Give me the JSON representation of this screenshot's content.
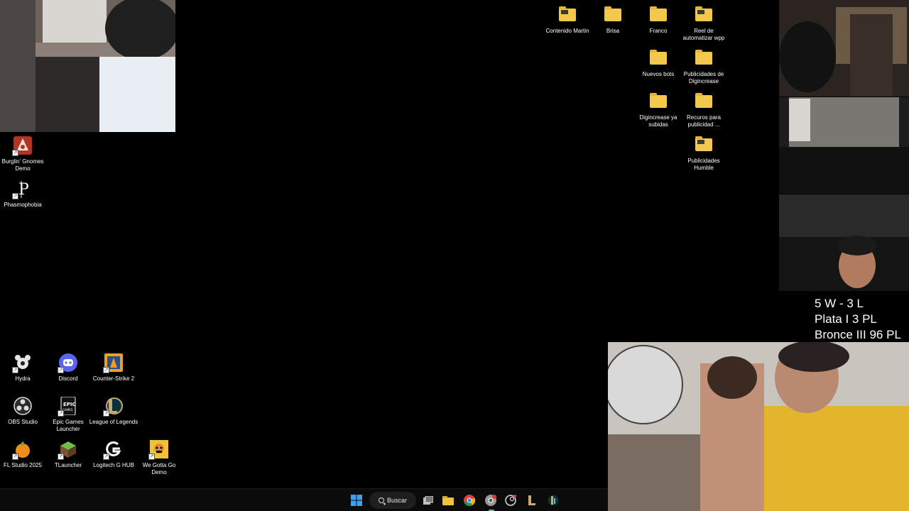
{
  "desktop_left_top": [
    {
      "label": "Burglin' Gnomes Demo",
      "icon": "gnome-game-icon",
      "color": "#c0392b"
    },
    {
      "label": "Phasmophobia",
      "icon": "phasmophobia-icon",
      "color": "#ffffff"
    }
  ],
  "desktop_left_bottom": [
    {
      "label": "Hydra",
      "icon": "hydra-icon",
      "color": "#dddddd"
    },
    {
      "label": "Discord",
      "icon": "discord-icon",
      "color": "#5865f2"
    },
    {
      "label": "Counter-Strike 2",
      "icon": "counter-strike-icon",
      "color": "#f0a020"
    },
    {
      "label": "OBS Studio",
      "icon": "obs-icon",
      "color": "#cfcfcf"
    },
    {
      "label": "Epic Games Launcher",
      "icon": "epic-games-icon",
      "color": "#ffffff"
    },
    {
      "label": "League of Legends",
      "icon": "league-of-legends-icon",
      "color": "#c8aa6e"
    },
    {
      "label": "FL Studio 2025",
      "icon": "fl-studio-icon",
      "color": "#f08c1c"
    },
    {
      "label": "TLauncher",
      "icon": "tlauncher-icon",
      "color": "#5fa83c"
    },
    {
      "label": "Logitech G HUB",
      "icon": "logitech-icon",
      "color": "#ffffff"
    },
    {
      "label": "We Gotta Go Demo",
      "icon": "we-gotta-go-icon",
      "color": "#f2c230"
    }
  ],
  "desktop_right": [
    {
      "label": "Contenido Martin",
      "icon": "folder-icon"
    },
    {
      "label": "Brisa",
      "icon": "folder-icon"
    },
    {
      "label": "Franco",
      "icon": "folder-icon"
    },
    {
      "label": "Reel de automatizar wpp",
      "icon": "folder-icon"
    },
    {
      "label": "Nuevos bots",
      "icon": "folder-icon"
    },
    {
      "label": "Publicidades de Digincrease",
      "icon": "folder-icon"
    },
    {
      "label": "Digincrease ya subidas",
      "icon": "folder-icon"
    },
    {
      "label": "Recuros para publicidad ...",
      "icon": "folder-icon"
    },
    {
      "label": "Publicidades Humble",
      "icon": "folder-icon"
    }
  ],
  "overlay": {
    "record": "5 W - 3 L",
    "rank1": "Plata I 3 PL",
    "rank2": "Bronce III 96 PL"
  },
  "taskbar": {
    "search_label": "Buscar",
    "items": [
      "windows-start-icon",
      "task-view-icon",
      "file-explorer-icon",
      "chrome-icon",
      "chrome-profile-icon",
      "steam-icon",
      "league-client-icon",
      "riot-client-icon"
    ]
  }
}
